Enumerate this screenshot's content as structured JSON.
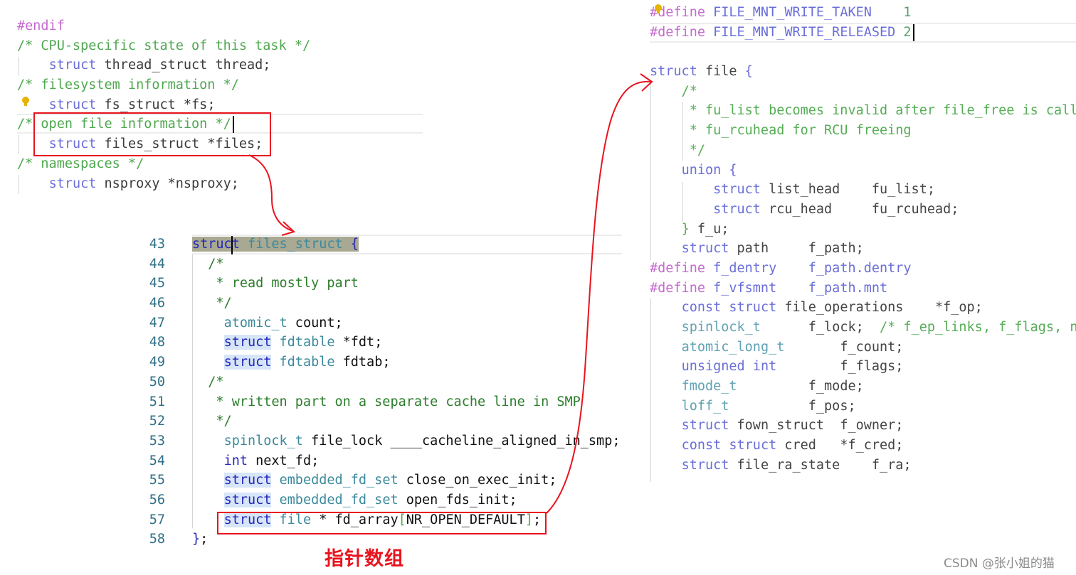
{
  "panels": {
    "task_struct": {
      "lines": [
        [
          [
            "p",
            "#endif"
          ]
        ],
        [
          [
            "c",
            "/* CPU-specific state of this task */"
          ]
        ],
        [
          [
            "i",
            "    "
          ],
          [
            "k",
            "struct"
          ],
          [
            "i",
            " thread_struct thread;"
          ]
        ],
        [
          [
            "c",
            "/* filesystem information */"
          ]
        ],
        [
          [
            "i",
            "    "
          ],
          [
            "k",
            "struct"
          ],
          [
            "i",
            " fs_struct *fs;"
          ]
        ],
        [
          [
            "c",
            "/* open file information */"
          ]
        ],
        [
          [
            "i",
            "    "
          ],
          [
            "k",
            "struct"
          ],
          [
            "i",
            " files_struct *files;"
          ]
        ],
        [
          [
            "c",
            "/* namespaces */"
          ]
        ],
        [
          [
            "i",
            "    "
          ],
          [
            "k",
            "struct"
          ],
          [
            "i",
            " nsproxy *nsproxy;"
          ]
        ]
      ]
    },
    "files_struct": {
      "line_numbers": [
        "43",
        "44",
        "45",
        "46",
        "47",
        "48",
        "49",
        "50",
        "51",
        "52",
        "53",
        "54",
        "55",
        "56",
        "57",
        "58"
      ],
      "lines": [
        [
          [
            "k",
            "struct"
          ],
          [
            "t",
            " files_struct "
          ],
          [
            "k",
            "{"
          ]
        ],
        [
          [
            "c",
            "  /*"
          ]
        ],
        [
          [
            "c",
            "   * read mostly part"
          ]
        ],
        [
          [
            "c",
            "   */"
          ]
        ],
        [
          [
            "i",
            "    "
          ],
          [
            "t",
            "atomic_t"
          ],
          [
            "i",
            " count;"
          ]
        ],
        [
          [
            "i",
            "    "
          ],
          [
            "k",
            "struct"
          ],
          [
            "t",
            " fdtable"
          ],
          [
            "i",
            " *fdt;"
          ]
        ],
        [
          [
            "i",
            "    "
          ],
          [
            "k",
            "struct"
          ],
          [
            "t",
            " fdtable"
          ],
          [
            "i",
            " fdtab;"
          ]
        ],
        [
          [
            "c",
            "  /*"
          ]
        ],
        [
          [
            "c",
            "   * written part on a separate cache line in SMP"
          ]
        ],
        [
          [
            "c",
            "   */"
          ]
        ],
        [
          [
            "i",
            "    "
          ],
          [
            "t",
            "spinlock_t"
          ],
          [
            "i",
            " file_lock ____cacheline_aligned_in_smp;"
          ]
        ],
        [
          [
            "i",
            "    "
          ],
          [
            "k",
            "int"
          ],
          [
            "i",
            " next_fd;"
          ]
        ],
        [
          [
            "i",
            "    "
          ],
          [
            "k",
            "struct"
          ],
          [
            "t",
            " embedded_fd_set"
          ],
          [
            "i",
            " close_on_exec_init;"
          ]
        ],
        [
          [
            "i",
            "    "
          ],
          [
            "k",
            "struct"
          ],
          [
            "t",
            " embedded_fd_set"
          ],
          [
            "i",
            " open_fds_init;"
          ]
        ],
        [
          [
            "i",
            "    "
          ],
          [
            "k",
            "struct"
          ],
          [
            "t",
            " file"
          ],
          [
            "i",
            " * fd_array"
          ],
          [
            "b",
            "["
          ],
          [
            "i",
            "NR_OPEN_DEFAULT"
          ],
          [
            "b",
            "]"
          ],
          [
            "i",
            ";"
          ]
        ],
        [
          [
            "k",
            "}"
          ],
          [
            "i",
            ";"
          ]
        ]
      ]
    },
    "file": {
      "lines": [
        [
          [
            "p",
            "#define"
          ],
          [
            "m",
            " FILE_MNT_WRITE_TAKEN"
          ],
          [
            "n",
            "    1"
          ]
        ],
        [
          [
            "p",
            "#define"
          ],
          [
            "m",
            " FILE_MNT_WRITE_RELEASED"
          ],
          [
            "n",
            " 2"
          ]
        ],
        [
          [
            "i",
            " "
          ]
        ],
        [
          [
            "k",
            "struct"
          ],
          [
            "i",
            " file "
          ],
          [
            "k",
            "{"
          ]
        ],
        [
          [
            "c",
            "    /*"
          ]
        ],
        [
          [
            "c",
            "     * fu_list becomes invalid after file_free is call"
          ]
        ],
        [
          [
            "c",
            "     * fu_rcuhead for RCU freeing"
          ]
        ],
        [
          [
            "c",
            "     */"
          ]
        ],
        [
          [
            "i",
            "    "
          ],
          [
            "k",
            "union"
          ],
          [
            "k",
            " {"
          ]
        ],
        [
          [
            "i",
            "        "
          ],
          [
            "k",
            "struct"
          ],
          [
            "i",
            " list_head    fu_list;"
          ]
        ],
        [
          [
            "i",
            "        "
          ],
          [
            "k",
            "struct"
          ],
          [
            "i",
            " rcu_head     fu_rcuhead;"
          ]
        ],
        [
          [
            "i",
            "    "
          ],
          [
            "c",
            "}"
          ],
          [
            "i",
            " f_u;"
          ]
        ],
        [
          [
            "i",
            "    "
          ],
          [
            "k",
            "struct"
          ],
          [
            "i",
            " path     f_path;"
          ]
        ],
        [
          [
            "p",
            "#define"
          ],
          [
            "m",
            " f_dentry    f_path.dentry"
          ]
        ],
        [
          [
            "p",
            "#define"
          ],
          [
            "m",
            " f_vfsmnt    f_path.mnt"
          ]
        ],
        [
          [
            "i",
            "    "
          ],
          [
            "k",
            "const struct"
          ],
          [
            "i",
            " file_operations    *f_op;"
          ]
        ],
        [
          [
            "i",
            "    "
          ],
          [
            "t",
            "spinlock_t"
          ],
          [
            "i",
            "      f_lock;  "
          ],
          [
            "c",
            "/* f_ep_links, f_flags, n"
          ]
        ],
        [
          [
            "i",
            "    "
          ],
          [
            "t",
            "atomic_long_t"
          ],
          [
            "i",
            "       f_count;"
          ]
        ],
        [
          [
            "i",
            "    "
          ],
          [
            "k",
            "unsigned int"
          ],
          [
            "i",
            "        f_flags;"
          ]
        ],
        [
          [
            "i",
            "    "
          ],
          [
            "t",
            "fmode_t"
          ],
          [
            "i",
            "         f_mode;"
          ]
        ],
        [
          [
            "i",
            "    "
          ],
          [
            "t",
            "loff_t"
          ],
          [
            "i",
            "          f_pos;"
          ]
        ],
        [
          [
            "i",
            "    "
          ],
          [
            "k",
            "struct"
          ],
          [
            "i",
            " fown_struct  f_owner;"
          ]
        ],
        [
          [
            "i",
            "    "
          ],
          [
            "k",
            "const struct"
          ],
          [
            "i",
            " cred   *f_cred;"
          ]
        ],
        [
          [
            "i",
            "    "
          ],
          [
            "k",
            "struct"
          ],
          [
            "i",
            " file_ra_state    f_ra;"
          ]
        ]
      ]
    }
  },
  "annotation_label": "指针数组",
  "watermark": "CSDN @张小姐的猫",
  "colors": {
    "annotation": "#e8141e",
    "keyword": "#6a6ed8",
    "comment": "#4fa84f",
    "preprocessor": "#c56ad0"
  }
}
